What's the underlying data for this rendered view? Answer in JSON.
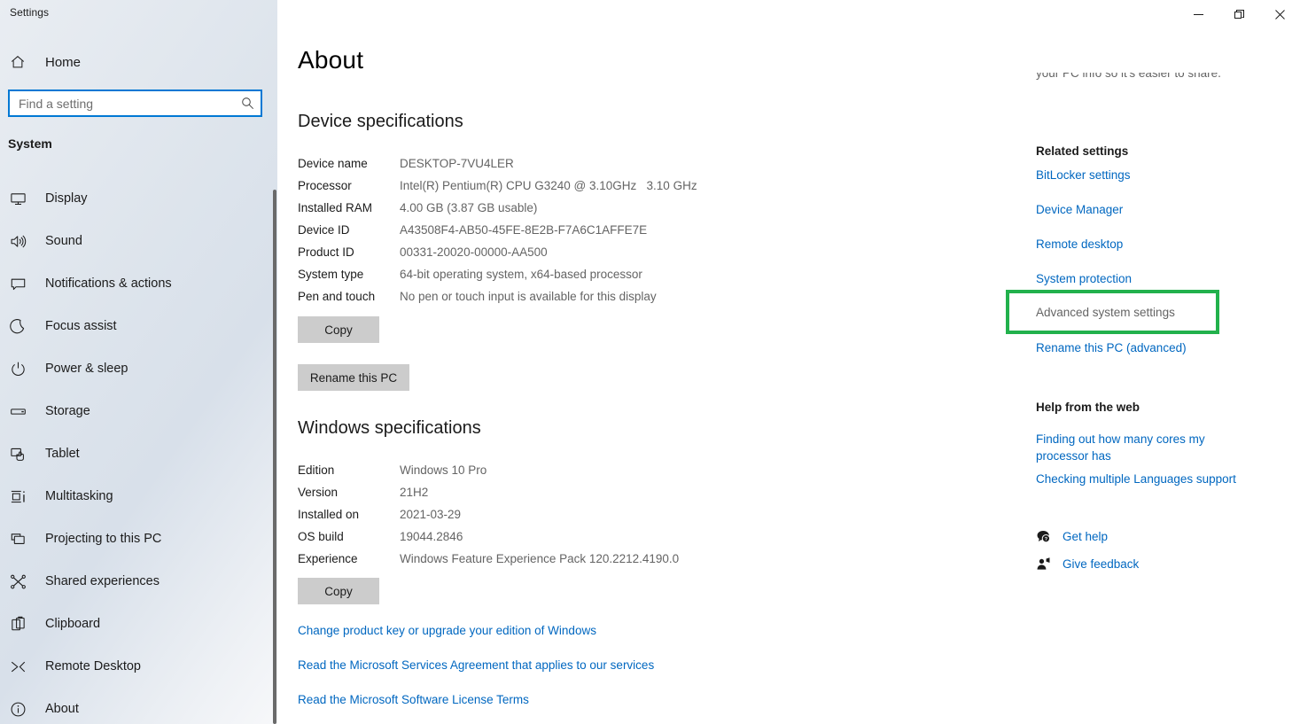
{
  "window": {
    "caption": "Settings",
    "controls": {
      "minimize": "minimize-button",
      "maximize": "restore-button",
      "close": "close-button"
    }
  },
  "sidebar": {
    "home_label": "Home",
    "home_icon": "home-icon",
    "search": {
      "placeholder": "Find a setting",
      "value": "",
      "icon": "search-icon"
    },
    "section_title": "System",
    "items": [
      {
        "label": "Display",
        "icon": "monitor-icon"
      },
      {
        "label": "Sound",
        "icon": "speaker-icon"
      },
      {
        "label": "Notifications & actions",
        "icon": "notification-icon"
      },
      {
        "label": "Focus assist",
        "icon": "moon-icon"
      },
      {
        "label": "Power & sleep",
        "icon": "power-icon"
      },
      {
        "label": "Storage",
        "icon": "drive-icon"
      },
      {
        "label": "Tablet",
        "icon": "tablet-icon"
      },
      {
        "label": "Multitasking",
        "icon": "multitasking-icon"
      },
      {
        "label": "Projecting to this PC",
        "icon": "project-screen-icon"
      },
      {
        "label": "Shared experiences",
        "icon": "share-nodes-icon"
      },
      {
        "label": "Clipboard",
        "icon": "clipboard-icon"
      },
      {
        "label": "Remote Desktop",
        "icon": "remote-desktop-icon"
      },
      {
        "label": "About",
        "icon": "info-icon"
      }
    ]
  },
  "main": {
    "page_title": "About",
    "device_specifications": {
      "heading": "Device specifications",
      "rows": [
        {
          "key": "Device name",
          "value": "DESKTOP-7VU4LER"
        },
        {
          "key": "Processor",
          "value": "Intel(R) Pentium(R) CPU G3240 @ 3.10GHz   3.10 GHz"
        },
        {
          "key": "Installed RAM",
          "value": "4.00 GB (3.87 GB usable)"
        },
        {
          "key": "Device ID",
          "value": "A43508F4-AB50-45FE-8E2B-F7A6C1AFFE7E"
        },
        {
          "key": "Product ID",
          "value": "00331-20020-00000-AA500"
        },
        {
          "key": "System type",
          "value": "64-bit operating system, x64-based processor"
        },
        {
          "key": "Pen and touch",
          "value": "No pen or touch input is available for this display"
        }
      ],
      "copy_label": "Copy",
      "rename_label": "Rename this PC"
    },
    "windows_specifications": {
      "heading": "Windows specifications",
      "rows": [
        {
          "key": "Edition",
          "value": "Windows 10 Pro"
        },
        {
          "key": "Version",
          "value": "21H2"
        },
        {
          "key": "Installed on",
          "value": "2021-03-29"
        },
        {
          "key": "OS build",
          "value": "19044.2846"
        },
        {
          "key": "Experience",
          "value": "Windows Feature Experience Pack 120.2212.4190.0"
        }
      ],
      "copy_label": "Copy"
    },
    "links": [
      "Change product key or upgrade your edition of Windows",
      "Read the Microsoft Services Agreement that applies to our services",
      "Read the Microsoft Software License Terms"
    ]
  },
  "right_rail": {
    "clipped_intro": "your PC info so it's easier to share.",
    "related_settings": {
      "heading": "Related settings",
      "links": [
        "BitLocker settings",
        "Device Manager",
        "Remote desktop",
        "System protection"
      ],
      "highlighted_link": "Advanced system settings",
      "rename_link": "Rename this PC (advanced)"
    },
    "help_from_web": {
      "heading": "Help from the web",
      "links": [
        "Finding out how many cores my processor has",
        "Checking multiple Languages support"
      ]
    },
    "actions": [
      {
        "label": "Get help",
        "icon": "help-bubble-icon"
      },
      {
        "label": "Give feedback",
        "icon": "feedback-person-icon"
      }
    ]
  },
  "colors": {
    "accent_blue": "#0078d4",
    "link_blue": "#0067c0",
    "highlight_green": "#22b14c",
    "button_gray": "#cccccc",
    "value_gray": "#646464"
  }
}
